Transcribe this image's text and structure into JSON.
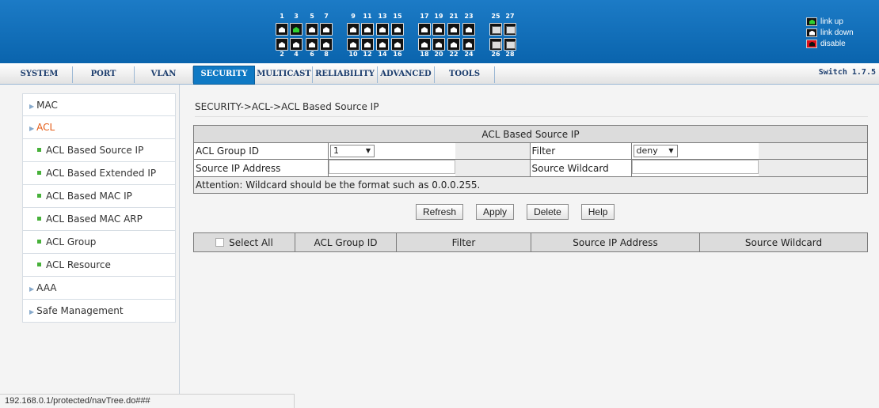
{
  "header": {
    "ports_top": [
      "1",
      "3",
      "5",
      "7",
      "9",
      "11",
      "13",
      "15",
      "17",
      "19",
      "21",
      "23",
      "25",
      "27"
    ],
    "ports_bottom": [
      "2",
      "4",
      "6",
      "8",
      "10",
      "12",
      "14",
      "16",
      "18",
      "20",
      "22",
      "24",
      "26",
      "28"
    ],
    "up_ports": [
      "3"
    ],
    "legend": {
      "link_up": "link up",
      "link_down": "link down",
      "disable": "disable"
    },
    "colors": {
      "banner": "#0a64ad",
      "link_up": "#2fd12f",
      "disable": "#e0101a"
    }
  },
  "nav": {
    "tabs": [
      "SYSTEM",
      "PORT",
      "VLAN",
      "SECURITY",
      "MULTICAST",
      "RELIABILITY",
      "ADVANCED",
      "TOOLS"
    ],
    "active_tab": "SECURITY",
    "version": "Switch 1.7.5"
  },
  "sidebar": {
    "items": [
      {
        "label": "MAC",
        "kind": "section"
      },
      {
        "label": "ACL",
        "kind": "section",
        "active": true
      },
      {
        "label": "ACL Based Source IP",
        "kind": "sub"
      },
      {
        "label": "ACL Based Extended IP",
        "kind": "sub"
      },
      {
        "label": "ACL Based MAC IP",
        "kind": "sub"
      },
      {
        "label": "ACL Based MAC ARP",
        "kind": "sub"
      },
      {
        "label": "ACL Group",
        "kind": "sub"
      },
      {
        "label": "ACL Resource",
        "kind": "sub"
      },
      {
        "label": "AAA",
        "kind": "section"
      },
      {
        "label": "Safe Management",
        "kind": "section"
      }
    ]
  },
  "main": {
    "breadcrumb": "SECURITY->ACL->ACL Based Source IP",
    "form": {
      "title": "ACL Based Source IP",
      "acl_group_id_label": "ACL Group ID",
      "acl_group_id_value": "1",
      "filter_label": "Filter",
      "filter_value": "deny",
      "source_ip_label": "Source IP Address",
      "source_ip_value": "",
      "source_wildcard_label": "Source Wildcard",
      "source_wildcard_value": "",
      "attention": "Attention: Wildcard should be the format such as 0.0.0.255."
    },
    "buttons": {
      "refresh": "Refresh",
      "apply": "Apply",
      "delete": "Delete",
      "help": "Help"
    },
    "list": {
      "select_all": "Select All",
      "columns": [
        "ACL Group ID",
        "Filter",
        "Source IP Address",
        "Source Wildcard"
      ]
    }
  },
  "statusbar": {
    "url": "192.168.0.1/protected/navTree.do###"
  }
}
